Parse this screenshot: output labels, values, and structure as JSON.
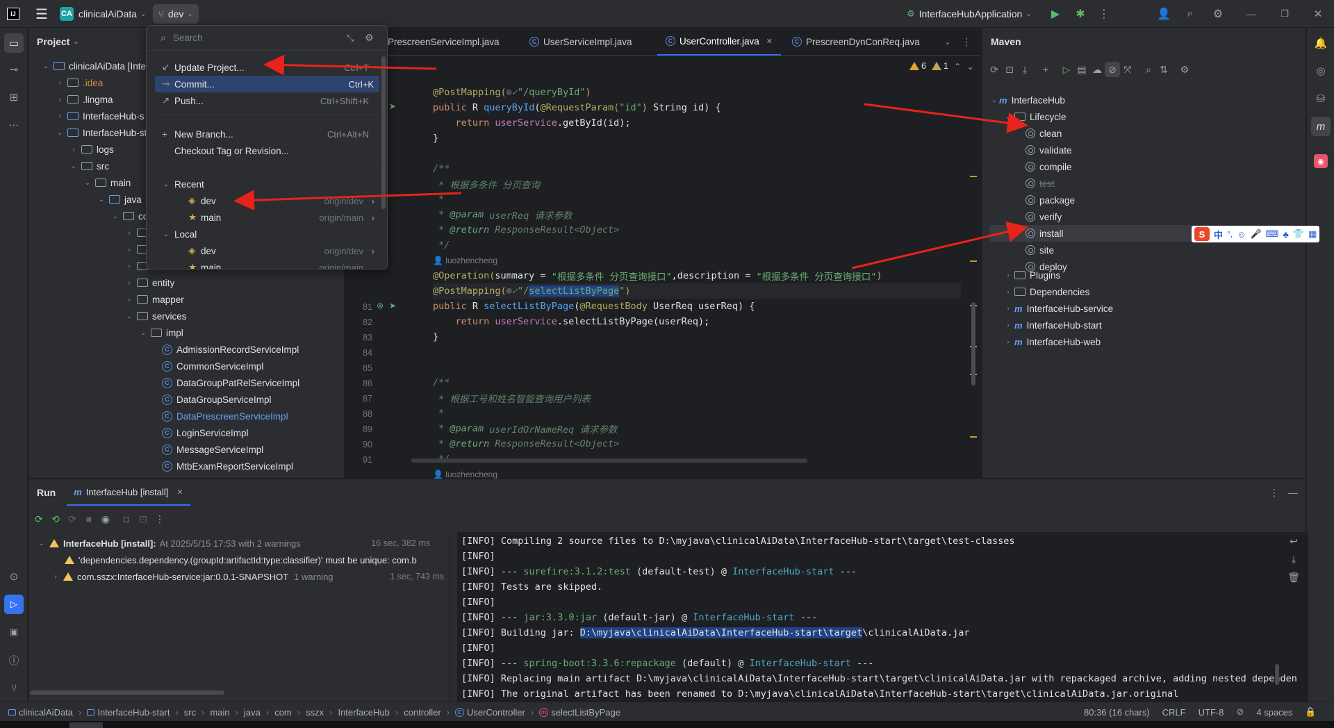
{
  "titlebar": {
    "project_badge": "CA",
    "project_name": "clinicalAiData",
    "branch": "dev",
    "run_config": "InterfaceHubApplication"
  },
  "vcs_popup": {
    "search_placeholder": "Search",
    "actions": [
      {
        "label": "Update Project...",
        "shortcut": "Ctrl+T"
      },
      {
        "label": "Commit...",
        "shortcut": "Ctrl+K"
      },
      {
        "label": "Push...",
        "shortcut": "Ctrl+Shift+K"
      }
    ],
    "new_branch": {
      "label": "New Branch...",
      "shortcut": "Ctrl+Alt+N"
    },
    "checkout": "Checkout Tag or Revision...",
    "recent_header": "Recent",
    "recent": [
      {
        "name": "dev",
        "remote": "origin/dev"
      },
      {
        "name": "main",
        "remote": "origin/main"
      }
    ],
    "local_header": "Local",
    "local": [
      {
        "name": "dev",
        "remote": "origin/dev"
      },
      {
        "name": "main",
        "remote": "origin/main"
      }
    ]
  },
  "project_panel": {
    "title": "Project",
    "tree": [
      {
        "label": "clinicalAiData [Inte",
        "level": 0,
        "kind": "module"
      },
      {
        "label": ".idea",
        "level": 1,
        "kind": "folder",
        "color": "#d08e3f"
      },
      {
        "label": ".lingma",
        "level": 1,
        "kind": "folder"
      },
      {
        "label": "InterfaceHub-s",
        "level": 1,
        "kind": "module"
      },
      {
        "label": "InterfaceHub-st",
        "level": 1,
        "kind": "module"
      },
      {
        "label": "logs",
        "level": 2,
        "kind": "folder"
      },
      {
        "label": "src",
        "level": 2,
        "kind": "folder"
      },
      {
        "label": "main",
        "level": 3,
        "kind": "folder"
      },
      {
        "label": "java",
        "level": 4,
        "kind": "folder-blue"
      },
      {
        "label": "cor",
        "level": 5,
        "kind": "package"
      },
      {
        "label": "",
        "level": 6,
        "kind": "package"
      },
      {
        "label": "",
        "level": 6,
        "kind": "package"
      },
      {
        "label": "controller",
        "level": 6,
        "kind": "package"
      },
      {
        "label": "entity",
        "level": 6,
        "kind": "package"
      },
      {
        "label": "mapper",
        "level": 6,
        "kind": "package"
      },
      {
        "label": "services",
        "level": 6,
        "kind": "package"
      },
      {
        "label": "impl",
        "level": 7,
        "kind": "package"
      },
      {
        "label": "AdmissionRecordServiceImpl",
        "level": 8,
        "kind": "class"
      },
      {
        "label": "CommonServiceImpl",
        "level": 8,
        "kind": "class"
      },
      {
        "label": "DataGroupPatRelServiceImpl",
        "level": 8,
        "kind": "class"
      },
      {
        "label": "DataGroupServiceImpl",
        "level": 8,
        "kind": "class"
      },
      {
        "label": "DataPrescreenServiceImpl",
        "level": 8,
        "kind": "class",
        "color": "#6c9ef8"
      },
      {
        "label": "LoginServiceImpl",
        "level": 8,
        "kind": "class"
      },
      {
        "label": "MessageServiceImpl",
        "level": 8,
        "kind": "class"
      },
      {
        "label": "MtbExamReportServiceImpl",
        "level": 8,
        "kind": "class"
      }
    ]
  },
  "editor": {
    "tabs": [
      {
        "label": "PrescreenServiceImpl.java"
      },
      {
        "label": "UserServiceImpl.java"
      },
      {
        "label": "UserController.java",
        "active": true
      },
      {
        "label": "PrescreenDynConReq.java"
      }
    ],
    "inspections": {
      "warnings": "6",
      "weak": "1"
    },
    "author": "luozhencheng",
    "line_numbers": [
      "81",
      "82",
      "83",
      "84",
      "85",
      "86",
      "87",
      "88",
      "89",
      "90",
      "91"
    ]
  },
  "maven": {
    "title": "Maven",
    "root": "InterfaceHub",
    "lifecycle": "Lifecycle",
    "goals": [
      "clean",
      "validate",
      "compile",
      "test",
      "package",
      "verify",
      "install",
      "site",
      "deploy"
    ],
    "plugins": "Plugins",
    "dependencies": "Dependencies",
    "modules": [
      "InterfaceHub-service",
      "InterfaceHub-start",
      "InterfaceHub-web"
    ]
  },
  "run": {
    "tab_run": "Run",
    "tab_config": "InterfaceHub [install]",
    "tree": [
      {
        "title": "InterfaceHub [install]:",
        "detail": "At 2025/5/15 17:53 with 2 warnings",
        "time": "16 sec, 382 ms"
      },
      {
        "title": "'dependencies.dependency.(groupId:artifactId:type:classifier)' must be unique: com.b",
        "detail": "",
        "time": ""
      },
      {
        "title": "com.sszx:InterfaceHub-service:jar:0.0.1-SNAPSHOT",
        "detail": "1 warning",
        "time": "1 sec, 743 ms"
      }
    ],
    "log": [
      {
        "prefix": "[INFO]",
        "text": " Compiling 2 source files to D:\\myjava\\clinicalAiData\\InterfaceHub-start\\target\\test-classes"
      },
      {
        "prefix": "[INFO]",
        "text": ""
      },
      {
        "prefix": "[INFO]",
        "pre": " --- ",
        "plugin": "surefire:3.1.2:test",
        "mid": " (default-test) @ ",
        "module": "InterfaceHub-start",
        "post": " ---"
      },
      {
        "prefix": "[INFO]",
        "text": " Tests are skipped."
      },
      {
        "prefix": "[INFO]",
        "text": ""
      },
      {
        "prefix": "[INFO]",
        "pre": " --- ",
        "plugin": "jar:3.3.0:jar",
        "mid": " (default-jar) @ ",
        "module": "InterfaceHub-start",
        "post": " ---"
      },
      {
        "prefix": "[INFO]",
        "text": " Building jar: ",
        "sel": "D:\\myjava\\clinicalAiData\\InterfaceHub-start\\target",
        "after": "\\clinicalAiData.jar"
      },
      {
        "prefix": "[INFO]",
        "text": ""
      },
      {
        "prefix": "[INFO]",
        "pre": " --- ",
        "plugin": "spring-boot:3.3.6:repackage",
        "mid": " (default) @ ",
        "module": "InterfaceHub-start",
        "post": " ---"
      },
      {
        "prefix": "[INFO]",
        "text": " Replacing main artifact D:\\myjava\\clinicalAiData\\InterfaceHub-start\\target\\clinicalAiData.jar with repackaged archive, adding nested dependen"
      },
      {
        "prefix": "[INFO]",
        "text": " The original artifact has been renamed to D:\\myjava\\clinicalAiData\\InterfaceHub-start\\target\\clinicalAiData.jar.original"
      }
    ]
  },
  "statusbar": {
    "crumbs": [
      "clinicalAiData",
      "InterfaceHub-start",
      "src",
      "main",
      "java",
      "com",
      "sszx",
      "InterfaceHub",
      "controller",
      "UserController",
      "selectListByPage"
    ],
    "position": "80:36 (16 chars)",
    "line_sep": "CRLF",
    "encoding": "UTF-8",
    "indent": "4 spaces"
  },
  "ime": {
    "label": "中"
  },
  "colors": {
    "accent": "#3574f0",
    "selection": "#214283",
    "arrow": "#e8231b",
    "warning": "#f2c55c"
  }
}
